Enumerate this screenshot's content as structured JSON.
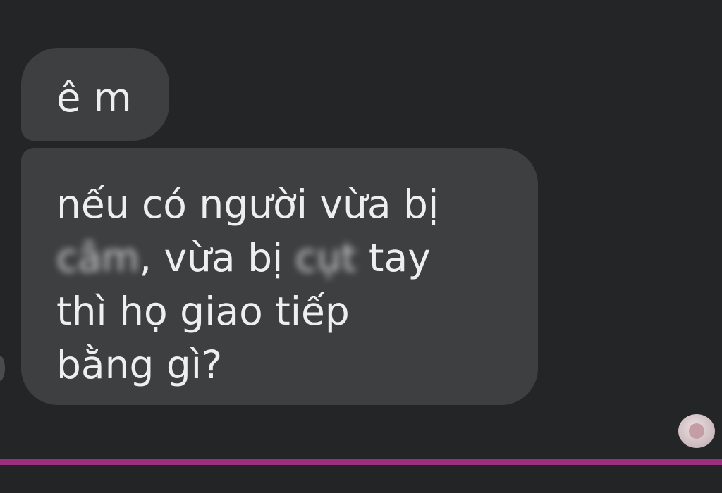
{
  "messages": [
    {
      "lines": [
        "ê m"
      ]
    },
    {
      "line1": "nếu có người vừa bị",
      "line2": {
        "redacted1": "câm",
        "middle": ", vừa bị ",
        "redacted2": "cụt",
        "end": " tay"
      },
      "line3": "thì họ giao tiếp",
      "line4": "bằng gì?"
    }
  ],
  "colors": {
    "background": "#242527",
    "bubble": "#3e3f41",
    "text": "#eeeeee",
    "divider": "#9b2f7f"
  },
  "icons": {
    "seen_avatar": "avatar-seen-indicator"
  }
}
